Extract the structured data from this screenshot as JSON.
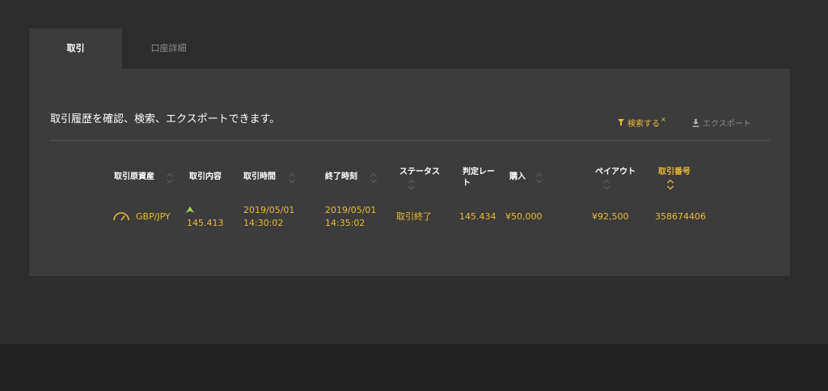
{
  "tabs": [
    {
      "label": "取引"
    },
    {
      "label": "口座詳細"
    }
  ],
  "description": "取引履歴を確認、検索、エクスポートできます。",
  "actions": {
    "search_label": "検索する",
    "search_close": "×",
    "export_label": "エクスポート"
  },
  "table": {
    "headers": [
      {
        "line1": "取引原資産",
        "line2": ""
      },
      {
        "line1": "取引内容",
        "line2": ""
      },
      {
        "line1": "取引時間",
        "line2": ""
      },
      {
        "line1": "終了時刻",
        "line2": ""
      },
      {
        "line1": "ステータス",
        "line2": ""
      },
      {
        "line1": "判定レー",
        "line2": "ト"
      },
      {
        "line1": "購入",
        "line2": ""
      },
      {
        "line1": "ペイアウト",
        "line2": ""
      },
      {
        "line1": "取引番号",
        "line2": ""
      }
    ],
    "rows": [
      {
        "asset": "GBP/JPY",
        "trade_rate": "145.413",
        "start_date": "2019/05/01",
        "start_time": "14:30:02",
        "end_date": "2019/05/01",
        "end_time": "14:35:02",
        "status": "取引終了",
        "judgment_rate": "145.434",
        "purchase": "¥50,000",
        "payout": "¥92,500",
        "trade_id": "358674406"
      }
    ]
  },
  "colors": {
    "accent": "#e8b93b",
    "up_arrow": "#a6d84a",
    "panel": "#3c3c3c",
    "background": "#2d2d2d"
  },
  "icons": {
    "search": "filter-icon",
    "export": "download-icon",
    "asset": "speedometer-icon",
    "direction": "up-arrow-icon"
  }
}
